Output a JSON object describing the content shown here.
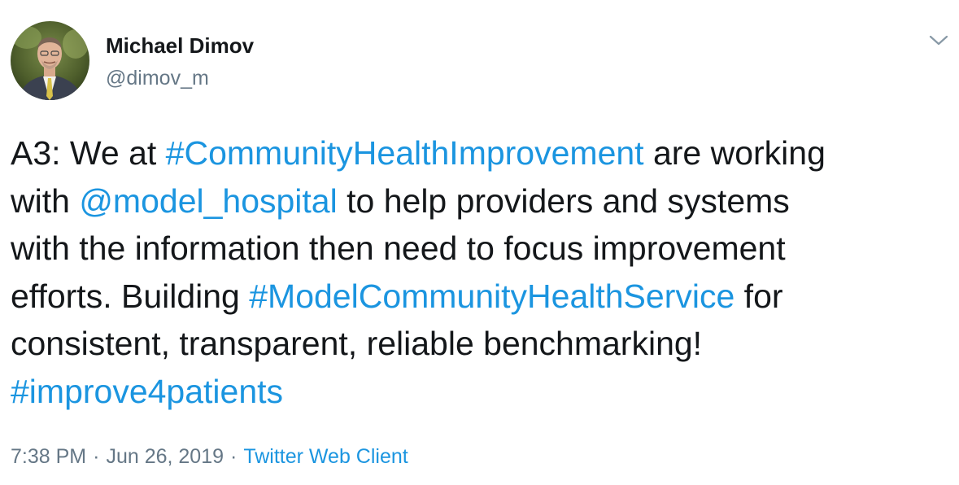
{
  "user": {
    "display_name": "Michael Dimov",
    "handle": "@dimov_m",
    "avatar": "profile-photo"
  },
  "menu": {
    "icon": "chevron-down-icon"
  },
  "tweet": {
    "lines": [
      [
        {
          "text": "A3: We at ",
          "type": "text"
        },
        {
          "text": "#CommunityHealthImprovement",
          "type": "hashtag"
        },
        {
          "text": " are working",
          "type": "text"
        }
      ],
      [
        {
          "text": "with ",
          "type": "text"
        },
        {
          "text": "@model_hospital",
          "type": "mention"
        },
        {
          "text": " to help providers and systems",
          "type": "text"
        }
      ],
      [
        {
          "text": "with the information then need to focus improvement",
          "type": "text"
        }
      ],
      [
        {
          "text": "efforts. Building ",
          "type": "text"
        },
        {
          "text": "#ModelCommunityHealthService",
          "type": "hashtag"
        },
        {
          "text": " for",
          "type": "text"
        }
      ],
      [
        {
          "text": "consistent, transparent, reliable benchmarking!",
          "type": "text"
        }
      ],
      [
        {
          "text": "#improve4patients",
          "type": "hashtag"
        }
      ]
    ]
  },
  "meta": {
    "time": "7:38 PM",
    "separator": "·",
    "date": "Jun 26, 2019",
    "client": "Twitter Web Client"
  },
  "colors": {
    "link": "#1b95e0",
    "text": "#14171a",
    "secondary": "#657786"
  }
}
